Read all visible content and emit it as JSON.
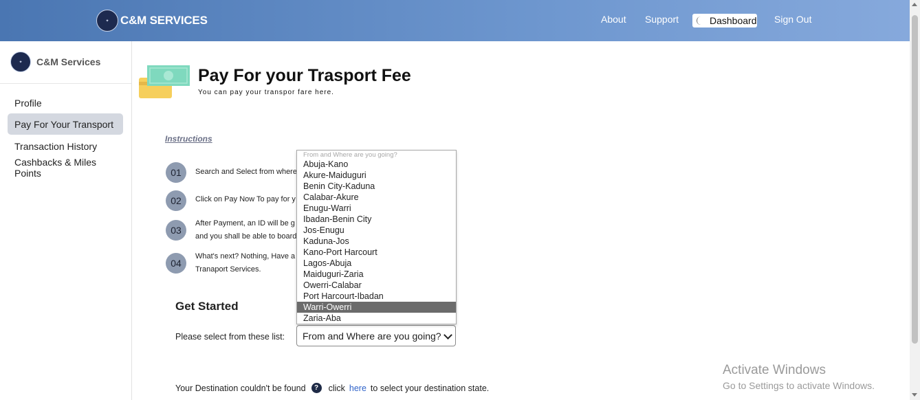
{
  "header": {
    "brand": "C&M SERVICES",
    "logo_text": "C&M SERVICES",
    "nav": {
      "about": "About",
      "support": "Support",
      "dashboard": "Dashboard",
      "signout": "Sign Out"
    }
  },
  "sidebar": {
    "brand": "C&M Services",
    "items": [
      {
        "label": "Profile"
      },
      {
        "label": "Pay For Your Transport",
        "active": true
      },
      {
        "label": "Transaction History"
      },
      {
        "label": "Cashbacks & Miles Points"
      }
    ]
  },
  "main": {
    "title": "Pay For your Trasport Fee",
    "subtitle": "You can pay your transpor fare here.",
    "instructions_label": "Instructions",
    "steps": [
      {
        "num": "01",
        "text": "Search and Select from where"
      },
      {
        "num": "02",
        "text": "Click on Pay Now To pay for y"
      },
      {
        "num": "03",
        "text": "After Payment, an ID will be g",
        "text2": "and you shall be able to board"
      },
      {
        "num": "04",
        "text": "What's next? Nothing, Have a",
        "text2": "Tranaport Services."
      }
    ],
    "get_started": "Get Started",
    "select_label": "Please select from these list:",
    "select_value": "From and Where are you going?",
    "dropdown": {
      "placeholder": "From and Where are you going?",
      "options": [
        "Abuja-Kano",
        "Akure-Maiduguri",
        "Benin City-Kaduna",
        "Calabar-Akure",
        "Enugu-Warri",
        "Ibadan-Benin City",
        "Jos-Enugu",
        "Kaduna-Jos",
        "Kano-Port Harcourt",
        "Lagos-Abuja",
        "Maiduguri-Zaria",
        "Owerri-Calabar",
        "Port Harcourt-Ibadan",
        "Warri-Owerri",
        "Zaria-Aba"
      ],
      "highlighted": "Warri-Owerri"
    },
    "bottom": {
      "prefix": "Your Destination couldn't be found",
      "click": "click",
      "link": "here",
      "suffix": "to select your destination state."
    }
  },
  "watermark": {
    "line1": "Activate Windows",
    "line2": "Go to Settings to activate Windows."
  },
  "colors": {
    "header_start": "#4a76b2",
    "header_end": "#86a9dc",
    "highlight": "#6b6b6b",
    "link": "#2f63c9"
  }
}
